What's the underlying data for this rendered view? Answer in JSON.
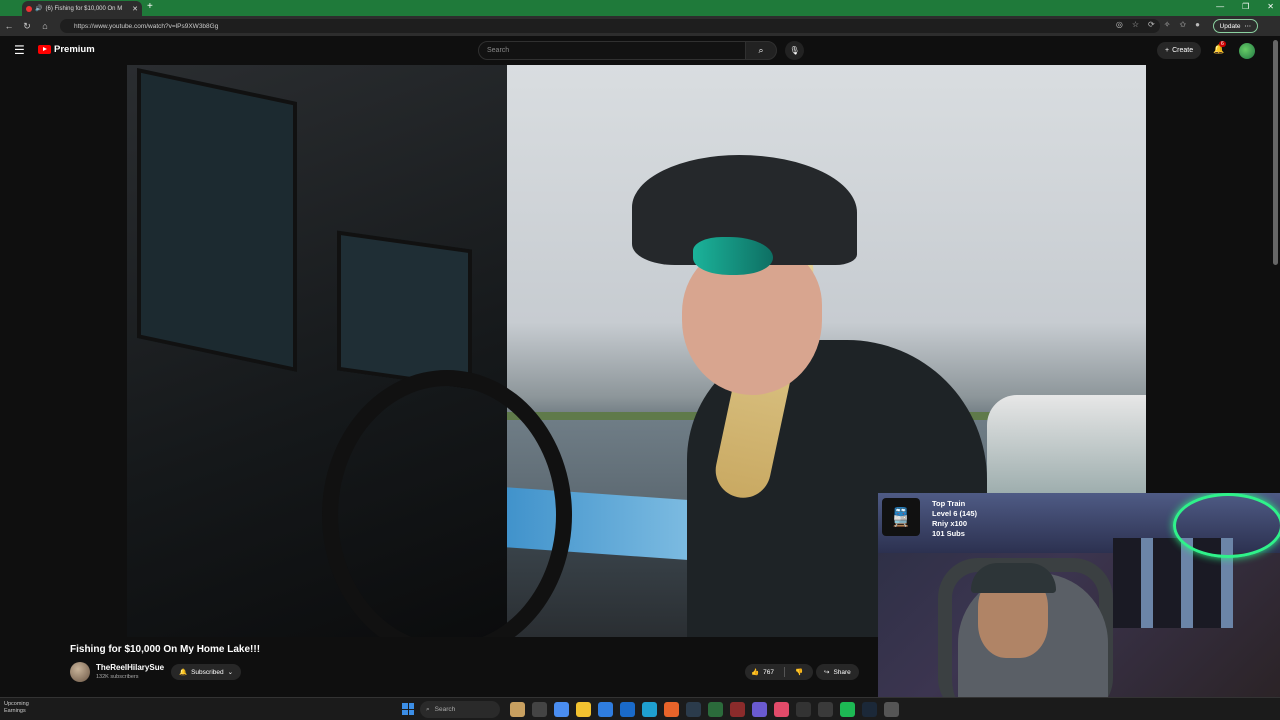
{
  "browser": {
    "tab_title": "(6) Fishing for $10,000 On M",
    "url": "https://www.youtube.com/watch?v=lPs9XW3b8Gg",
    "update_label": "Update"
  },
  "youtube": {
    "logo_text": "Premium",
    "search_placeholder": "Search",
    "create_label": "Create",
    "notification_count": "6"
  },
  "video": {
    "title": "Fishing for $10,000 On My Home Lake!!!",
    "channel_name": "TheReelHilarySue",
    "subscribers": "132K subscribers",
    "subscribed_label": "Subscribed",
    "like_count": "767",
    "share_label": "Share"
  },
  "overlay": {
    "line1": "Top Train",
    "line2": "Level 6  (145)",
    "line3": "Rniy x100",
    "line4": "101 Subs"
  },
  "taskbar": {
    "news_title": "Upcoming",
    "news_sub": "Earnings",
    "search_label": "Search"
  }
}
